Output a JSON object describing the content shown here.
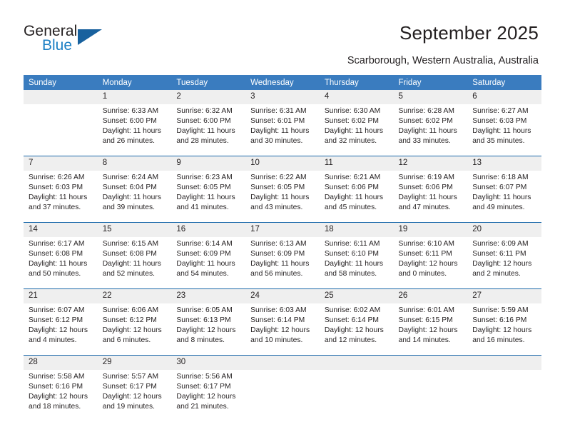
{
  "brand": {
    "name_part1": "General",
    "name_part2": "Blue"
  },
  "header": {
    "title": "September 2025",
    "subtitle": "Scarborough, Western Australia, Australia"
  },
  "colors": {
    "header_blue": "#3a7cbf",
    "row_divider_blue": "#1d6aab",
    "daynum_band": "#efefef",
    "logo_blue": "#1c7fc4",
    "text": "#231f20"
  },
  "weekday_headers": [
    "Sunday",
    "Monday",
    "Tuesday",
    "Wednesday",
    "Thursday",
    "Friday",
    "Saturday"
  ],
  "weeks": [
    [
      {
        "day": ""
      },
      {
        "day": "1",
        "sunrise": "Sunrise: 6:33 AM",
        "sunset": "Sunset: 6:00 PM",
        "daylight1": "Daylight: 11 hours",
        "daylight2": "and 26 minutes."
      },
      {
        "day": "2",
        "sunrise": "Sunrise: 6:32 AM",
        "sunset": "Sunset: 6:00 PM",
        "daylight1": "Daylight: 11 hours",
        "daylight2": "and 28 minutes."
      },
      {
        "day": "3",
        "sunrise": "Sunrise: 6:31 AM",
        "sunset": "Sunset: 6:01 PM",
        "daylight1": "Daylight: 11 hours",
        "daylight2": "and 30 minutes."
      },
      {
        "day": "4",
        "sunrise": "Sunrise: 6:30 AM",
        "sunset": "Sunset: 6:02 PM",
        "daylight1": "Daylight: 11 hours",
        "daylight2": "and 32 minutes."
      },
      {
        "day": "5",
        "sunrise": "Sunrise: 6:28 AM",
        "sunset": "Sunset: 6:02 PM",
        "daylight1": "Daylight: 11 hours",
        "daylight2": "and 33 minutes."
      },
      {
        "day": "6",
        "sunrise": "Sunrise: 6:27 AM",
        "sunset": "Sunset: 6:03 PM",
        "daylight1": "Daylight: 11 hours",
        "daylight2": "and 35 minutes."
      }
    ],
    [
      {
        "day": "7",
        "sunrise": "Sunrise: 6:26 AM",
        "sunset": "Sunset: 6:03 PM",
        "daylight1": "Daylight: 11 hours",
        "daylight2": "and 37 minutes."
      },
      {
        "day": "8",
        "sunrise": "Sunrise: 6:24 AM",
        "sunset": "Sunset: 6:04 PM",
        "daylight1": "Daylight: 11 hours",
        "daylight2": "and 39 minutes."
      },
      {
        "day": "9",
        "sunrise": "Sunrise: 6:23 AM",
        "sunset": "Sunset: 6:05 PM",
        "daylight1": "Daylight: 11 hours",
        "daylight2": "and 41 minutes."
      },
      {
        "day": "10",
        "sunrise": "Sunrise: 6:22 AM",
        "sunset": "Sunset: 6:05 PM",
        "daylight1": "Daylight: 11 hours",
        "daylight2": "and 43 minutes."
      },
      {
        "day": "11",
        "sunrise": "Sunrise: 6:21 AM",
        "sunset": "Sunset: 6:06 PM",
        "daylight1": "Daylight: 11 hours",
        "daylight2": "and 45 minutes."
      },
      {
        "day": "12",
        "sunrise": "Sunrise: 6:19 AM",
        "sunset": "Sunset: 6:06 PM",
        "daylight1": "Daylight: 11 hours",
        "daylight2": "and 47 minutes."
      },
      {
        "day": "13",
        "sunrise": "Sunrise: 6:18 AM",
        "sunset": "Sunset: 6:07 PM",
        "daylight1": "Daylight: 11 hours",
        "daylight2": "and 49 minutes."
      }
    ],
    [
      {
        "day": "14",
        "sunrise": "Sunrise: 6:17 AM",
        "sunset": "Sunset: 6:08 PM",
        "daylight1": "Daylight: 11 hours",
        "daylight2": "and 50 minutes."
      },
      {
        "day": "15",
        "sunrise": "Sunrise: 6:15 AM",
        "sunset": "Sunset: 6:08 PM",
        "daylight1": "Daylight: 11 hours",
        "daylight2": "and 52 minutes."
      },
      {
        "day": "16",
        "sunrise": "Sunrise: 6:14 AM",
        "sunset": "Sunset: 6:09 PM",
        "daylight1": "Daylight: 11 hours",
        "daylight2": "and 54 minutes."
      },
      {
        "day": "17",
        "sunrise": "Sunrise: 6:13 AM",
        "sunset": "Sunset: 6:09 PM",
        "daylight1": "Daylight: 11 hours",
        "daylight2": "and 56 minutes."
      },
      {
        "day": "18",
        "sunrise": "Sunrise: 6:11 AM",
        "sunset": "Sunset: 6:10 PM",
        "daylight1": "Daylight: 11 hours",
        "daylight2": "and 58 minutes."
      },
      {
        "day": "19",
        "sunrise": "Sunrise: 6:10 AM",
        "sunset": "Sunset: 6:11 PM",
        "daylight1": "Daylight: 12 hours",
        "daylight2": "and 0 minutes."
      },
      {
        "day": "20",
        "sunrise": "Sunrise: 6:09 AM",
        "sunset": "Sunset: 6:11 PM",
        "daylight1": "Daylight: 12 hours",
        "daylight2": "and 2 minutes."
      }
    ],
    [
      {
        "day": "21",
        "sunrise": "Sunrise: 6:07 AM",
        "sunset": "Sunset: 6:12 PM",
        "daylight1": "Daylight: 12 hours",
        "daylight2": "and 4 minutes."
      },
      {
        "day": "22",
        "sunrise": "Sunrise: 6:06 AM",
        "sunset": "Sunset: 6:12 PM",
        "daylight1": "Daylight: 12 hours",
        "daylight2": "and 6 minutes."
      },
      {
        "day": "23",
        "sunrise": "Sunrise: 6:05 AM",
        "sunset": "Sunset: 6:13 PM",
        "daylight1": "Daylight: 12 hours",
        "daylight2": "and 8 minutes."
      },
      {
        "day": "24",
        "sunrise": "Sunrise: 6:03 AM",
        "sunset": "Sunset: 6:14 PM",
        "daylight1": "Daylight: 12 hours",
        "daylight2": "and 10 minutes."
      },
      {
        "day": "25",
        "sunrise": "Sunrise: 6:02 AM",
        "sunset": "Sunset: 6:14 PM",
        "daylight1": "Daylight: 12 hours",
        "daylight2": "and 12 minutes."
      },
      {
        "day": "26",
        "sunrise": "Sunrise: 6:01 AM",
        "sunset": "Sunset: 6:15 PM",
        "daylight1": "Daylight: 12 hours",
        "daylight2": "and 14 minutes."
      },
      {
        "day": "27",
        "sunrise": "Sunrise: 5:59 AM",
        "sunset": "Sunset: 6:16 PM",
        "daylight1": "Daylight: 12 hours",
        "daylight2": "and 16 minutes."
      }
    ],
    [
      {
        "day": "28",
        "sunrise": "Sunrise: 5:58 AM",
        "sunset": "Sunset: 6:16 PM",
        "daylight1": "Daylight: 12 hours",
        "daylight2": "and 18 minutes."
      },
      {
        "day": "29",
        "sunrise": "Sunrise: 5:57 AM",
        "sunset": "Sunset: 6:17 PM",
        "daylight1": "Daylight: 12 hours",
        "daylight2": "and 19 minutes."
      },
      {
        "day": "30",
        "sunrise": "Sunrise: 5:56 AM",
        "sunset": "Sunset: 6:17 PM",
        "daylight1": "Daylight: 12 hours",
        "daylight2": "and 21 minutes."
      },
      {
        "day": ""
      },
      {
        "day": ""
      },
      {
        "day": ""
      },
      {
        "day": ""
      }
    ]
  ]
}
